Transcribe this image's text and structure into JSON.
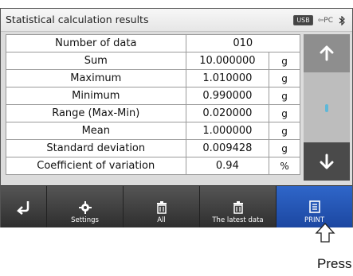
{
  "header": {
    "title": "Statistical calculation results",
    "usb_label": "USB",
    "pc_label": "⇦PC"
  },
  "rows": [
    {
      "label": "Number of data",
      "value": "010",
      "unit": ""
    },
    {
      "label": "Sum",
      "value": "10.000000",
      "unit": "g"
    },
    {
      "label": "Maximum",
      "value": "1.010000",
      "unit": "g"
    },
    {
      "label": "Minimum",
      "value": "0.990000",
      "unit": "g"
    },
    {
      "label": "Range (Max-Min)",
      "value": "0.020000",
      "unit": "g"
    },
    {
      "label": "Mean",
      "value": "1.000000",
      "unit": "g"
    },
    {
      "label": "Standard deviation",
      "value": "0.009428",
      "unit": "g"
    },
    {
      "label": "Coefficient of variation",
      "value": "0.94",
      "unit": "%"
    }
  ],
  "toolbar": {
    "settings_label": "Settings",
    "all_label": "All",
    "latest_label": "The latest data",
    "print_label": "PRINT"
  },
  "caption": "Press",
  "colors": {
    "print_button": "#2a5bbf",
    "toolbar_bg": "#3b3b3b",
    "scroll_indicator": "#5fb8d8"
  },
  "icons": [
    "back-arrow-icon",
    "gear-icon",
    "trash-icon",
    "print-icon",
    "arrow-up-icon",
    "arrow-down-icon",
    "bluetooth-icon",
    "pointer-hand-icon"
  ]
}
